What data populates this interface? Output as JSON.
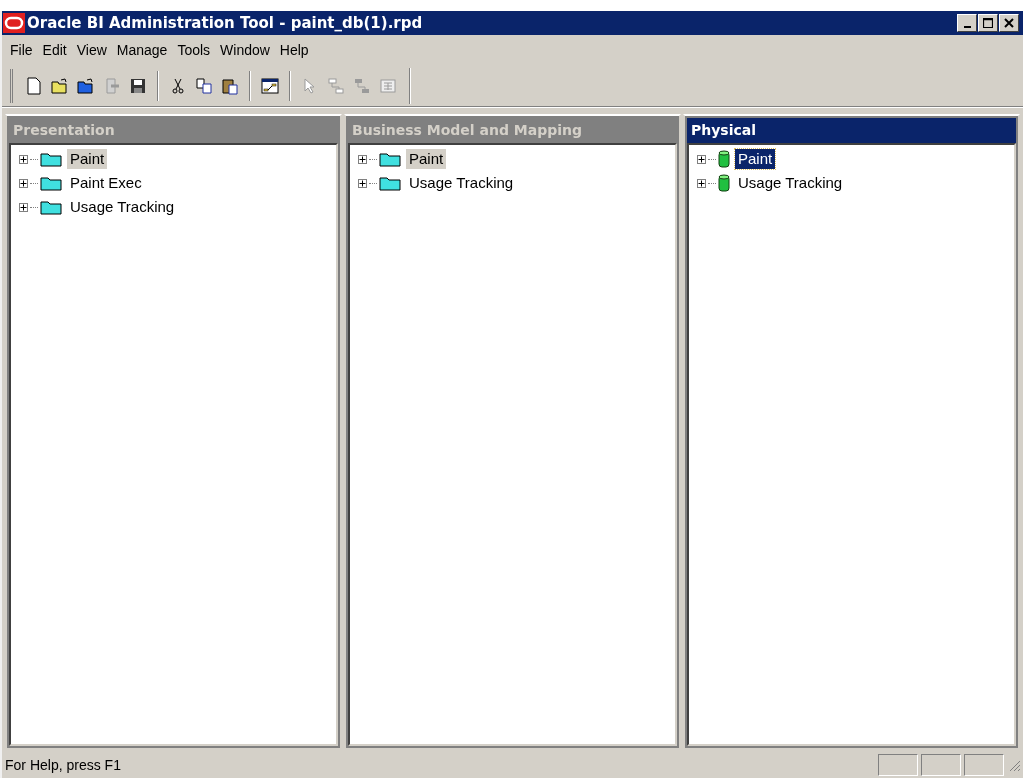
{
  "window": {
    "title": "Oracle BI Administration Tool - paint_db(1).rpd"
  },
  "menu": [
    "File",
    "Edit",
    "View",
    "Manage",
    "Tools",
    "Window",
    "Help"
  ],
  "toolbar": [
    {
      "kind": "new",
      "disabled": false
    },
    {
      "kind": "open",
      "disabled": false
    },
    {
      "kind": "open-online",
      "disabled": false
    },
    {
      "kind": "check-in",
      "disabled": true
    },
    {
      "kind": "save",
      "disabled": false
    },
    {
      "kind": "separator"
    },
    {
      "kind": "cut",
      "disabled": false
    },
    {
      "kind": "copy",
      "disabled": false
    },
    {
      "kind": "paste",
      "disabled": false
    },
    {
      "kind": "separator"
    },
    {
      "kind": "diagram",
      "disabled": false
    },
    {
      "kind": "separator"
    },
    {
      "kind": "pointer",
      "disabled": true
    },
    {
      "kind": "join",
      "disabled": true
    },
    {
      "kind": "complex-join",
      "disabled": true
    },
    {
      "kind": "table",
      "disabled": true
    }
  ],
  "panes": [
    {
      "title": "Presentation",
      "active": false,
      "items": [
        {
          "label": "Paint",
          "kind": "folder",
          "selected": true
        },
        {
          "label": "Paint Exec",
          "kind": "folder",
          "selected": false
        },
        {
          "label": "Usage Tracking",
          "kind": "folder",
          "selected": false
        }
      ]
    },
    {
      "title": "Business Model and Mapping",
      "active": false,
      "items": [
        {
          "label": "Paint",
          "kind": "folder",
          "selected": true
        },
        {
          "label": "Usage Tracking",
          "kind": "folder",
          "selected": false
        }
      ]
    },
    {
      "title": "Physical",
      "active": true,
      "items": [
        {
          "label": "Paint",
          "kind": "database",
          "selected": true
        },
        {
          "label": "Usage Tracking",
          "kind": "database",
          "selected": false
        }
      ]
    }
  ],
  "status_bar": {
    "text": "For Help, press F1"
  }
}
